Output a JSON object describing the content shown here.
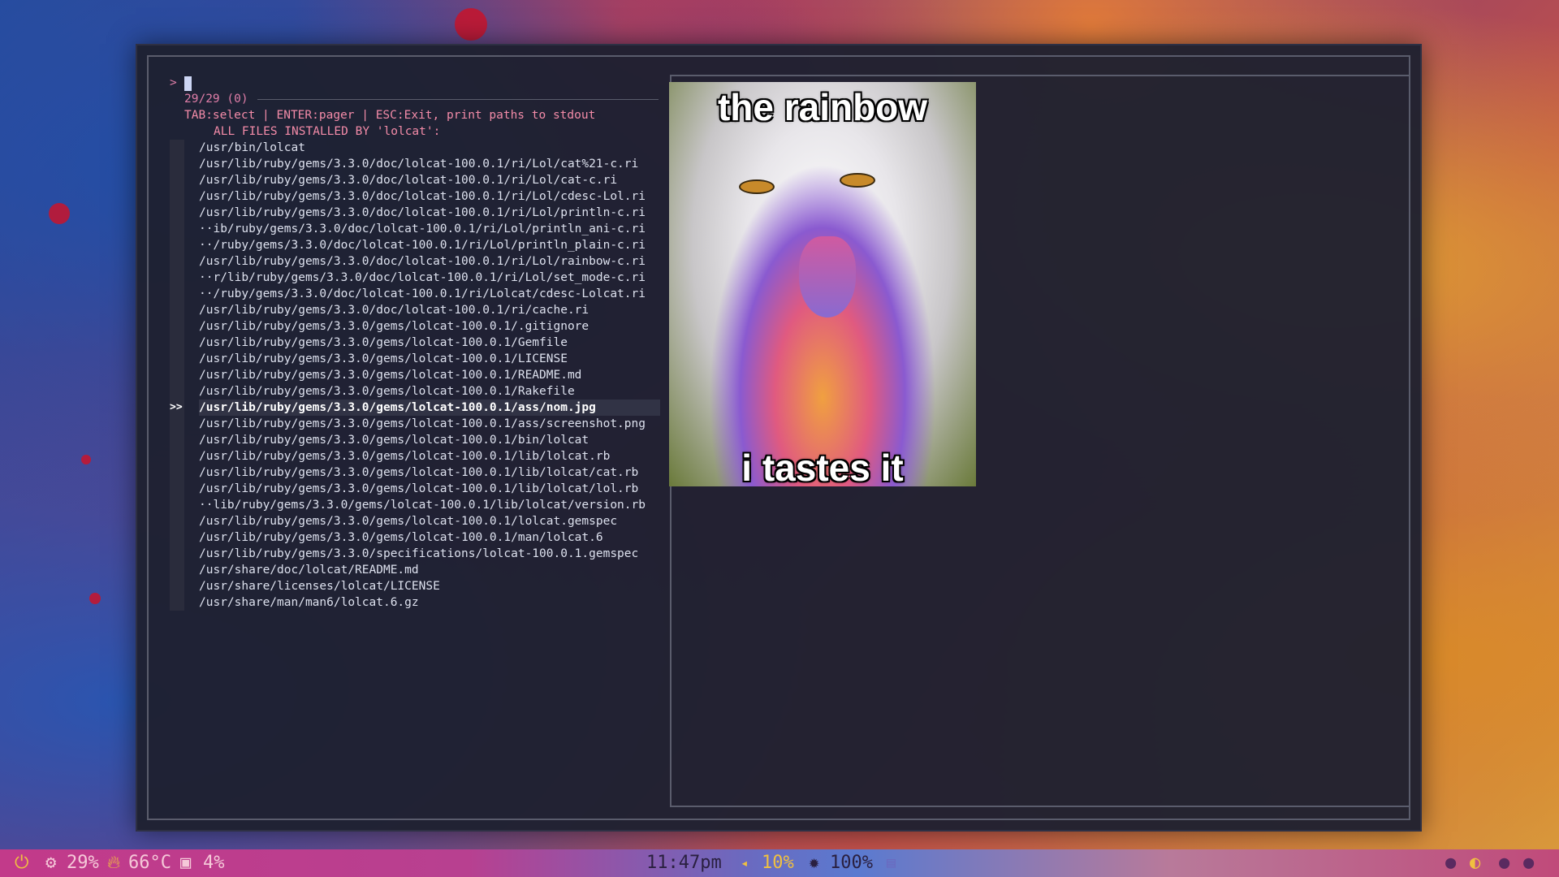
{
  "finder": {
    "prompt_symbol": ">",
    "count": "29/29 (0)",
    "help": "TAB:select | ENTER:pager | ESC:Exit, print paths to stdout",
    "header": "ALL FILES INSTALLED BY 'lolcat':",
    "selected_marker": ">>",
    "selected_index": 16,
    "files": [
      "/usr/bin/lolcat",
      "/usr/lib/ruby/gems/3.3.0/doc/lolcat-100.0.1/ri/Lol/cat%21-c.ri",
      "/usr/lib/ruby/gems/3.3.0/doc/lolcat-100.0.1/ri/Lol/cat-c.ri",
      "/usr/lib/ruby/gems/3.3.0/doc/lolcat-100.0.1/ri/Lol/cdesc-Lol.ri",
      "/usr/lib/ruby/gems/3.3.0/doc/lolcat-100.0.1/ri/Lol/println-c.ri",
      "··ib/ruby/gems/3.3.0/doc/lolcat-100.0.1/ri/Lol/println_ani-c.ri",
      "··/ruby/gems/3.3.0/doc/lolcat-100.0.1/ri/Lol/println_plain-c.ri",
      "/usr/lib/ruby/gems/3.3.0/doc/lolcat-100.0.1/ri/Lol/rainbow-c.ri",
      "··r/lib/ruby/gems/3.3.0/doc/lolcat-100.0.1/ri/Lol/set_mode-c.ri",
      "··/ruby/gems/3.3.0/doc/lolcat-100.0.1/ri/Lolcat/cdesc-Lolcat.ri",
      "/usr/lib/ruby/gems/3.3.0/doc/lolcat-100.0.1/ri/cache.ri",
      "/usr/lib/ruby/gems/3.3.0/gems/lolcat-100.0.1/.gitignore",
      "/usr/lib/ruby/gems/3.3.0/gems/lolcat-100.0.1/Gemfile",
      "/usr/lib/ruby/gems/3.3.0/gems/lolcat-100.0.1/LICENSE",
      "/usr/lib/ruby/gems/3.3.0/gems/lolcat-100.0.1/README.md",
      "/usr/lib/ruby/gems/3.3.0/gems/lolcat-100.0.1/Rakefile",
      "/usr/lib/ruby/gems/3.3.0/gems/lolcat-100.0.1/ass/nom.jpg",
      "/usr/lib/ruby/gems/3.3.0/gems/lolcat-100.0.1/ass/screenshot.png",
      "/usr/lib/ruby/gems/3.3.0/gems/lolcat-100.0.1/bin/lolcat",
      "/usr/lib/ruby/gems/3.3.0/gems/lolcat-100.0.1/lib/lolcat.rb",
      "/usr/lib/ruby/gems/3.3.0/gems/lolcat-100.0.1/lib/lolcat/cat.rb",
      "/usr/lib/ruby/gems/3.3.0/gems/lolcat-100.0.1/lib/lolcat/lol.rb",
      "··lib/ruby/gems/3.3.0/gems/lolcat-100.0.1/lib/lolcat/version.rb",
      "/usr/lib/ruby/gems/3.3.0/gems/lolcat-100.0.1/lolcat.gemspec",
      "/usr/lib/ruby/gems/3.3.0/gems/lolcat-100.0.1/man/lolcat.6",
      "/usr/lib/ruby/gems/3.3.0/specifications/lolcat-100.0.1.gemspec",
      "/usr/share/doc/lolcat/README.md",
      "/usr/share/licenses/lolcat/LICENSE",
      "/usr/share/man/man6/lolcat.6.gz"
    ]
  },
  "preview": {
    "caption_top": "the rainbow",
    "caption_bottom": "i tastes it"
  },
  "statusbar": {
    "power_icon": "power-icon",
    "cpu_icon": "cpu-icon",
    "cpu": "29%",
    "temp_icon": "flame-icon",
    "temp": "66°C",
    "mem_icon": "memory-icon",
    "mem": "4%",
    "time": "11:47pm",
    "volume_icon": "speaker-icon",
    "volume": "10%",
    "brightness_icon": "brightness-icon",
    "brightness": "100%",
    "clipboard_icon": "clipboard-icon",
    "accent_color": "#f0c040"
  }
}
